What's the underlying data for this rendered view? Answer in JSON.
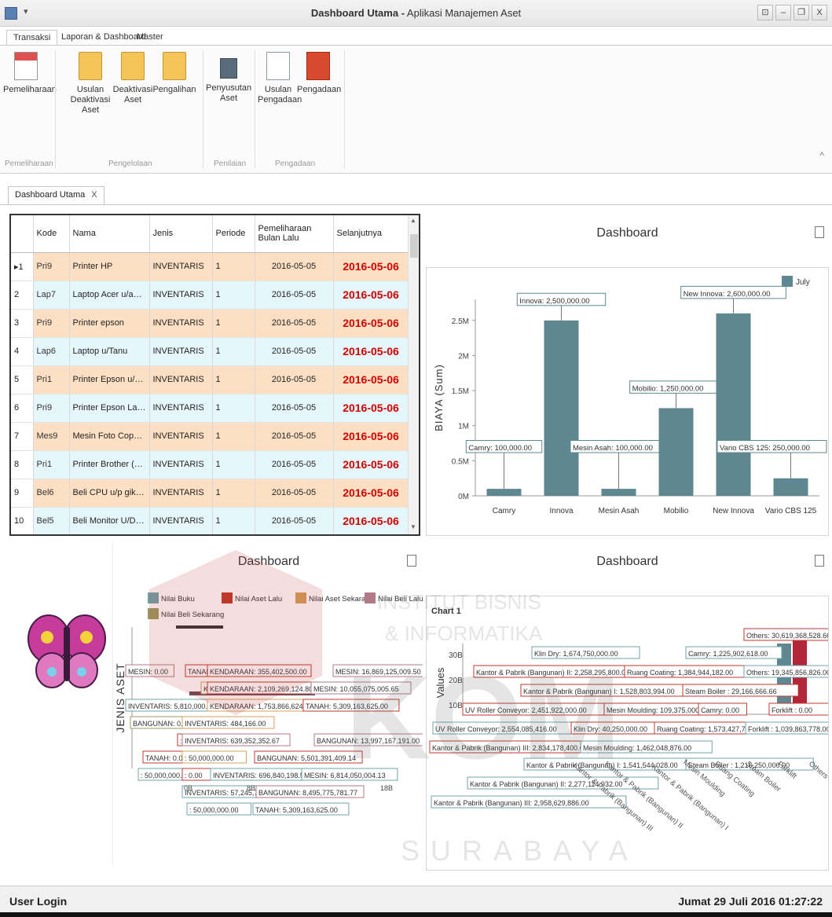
{
  "window": {
    "title_bold": "Dashboard Utama -",
    "title_rest": " Aplikasi Manajemen Aset",
    "qa_glyph": "▾",
    "controls": [
      "⊡",
      "–",
      "❐",
      "X"
    ]
  },
  "ribbon_tabs": [
    "Transaksi",
    "Laporan & Dashboard",
    "Master"
  ],
  "ribbon": {
    "buttons": [
      {
        "label1": "Pemeliharaan",
        "label2": ""
      },
      {
        "label1": "Usulan",
        "label2": "Deaktivasi Aset"
      },
      {
        "label1": "Deaktivasi",
        "label2": "Aset"
      },
      {
        "label1": "Pengalihan",
        "label2": ""
      },
      {
        "label1": "Penyusutan",
        "label2": "Aset"
      },
      {
        "label1": "Usulan",
        "label2": "Pengadaan"
      },
      {
        "label1": "Pengadaan",
        "label2": ""
      }
    ],
    "groups": [
      "Pemeliharaan",
      "Pengelolaan",
      "Penilaian",
      "Pengadaan"
    ],
    "collapse_glyph": "^"
  },
  "doc_tab": {
    "label": "Dashboard Utama",
    "close": "X"
  },
  "grid": {
    "columns": [
      "",
      "Kode",
      "Nama",
      "Jenis",
      "Periode",
      "Pemeliharaan Bulan Lalu",
      "Selanjutnya"
    ],
    "rows": [
      {
        "no": "▸1",
        "kode": "Pri9",
        "nama": "Printer HP",
        "jenis": "INVENTARIS",
        "periode": "1",
        "lalu": "2016-05-05",
        "next": "2016-05-06"
      },
      {
        "no": "2",
        "kode": "Lap7",
        "nama": "Laptop Acer u/aciek",
        "jenis": "INVENTARIS",
        "periode": "1",
        "lalu": "2016-05-05",
        "next": "2016-05-06"
      },
      {
        "no": "3",
        "kode": "Pri9",
        "nama": "Printer epson",
        "jenis": "INVENTARIS",
        "periode": "1",
        "lalu": "2016-05-05",
        "next": "2016-05-06"
      },
      {
        "no": "4",
        "kode": "Lap6",
        "nama": "Laptop u/Tanu",
        "jenis": "INVENTARIS",
        "periode": "1",
        "lalu": "2016-05-05",
        "next": "2016-05-06"
      },
      {
        "no": "5",
        "kode": "Pri1",
        "nama": "Printer Epson u/kantor...",
        "jenis": "INVENTARIS",
        "periode": "1",
        "lalu": "2016-05-05",
        "next": "2016-05-06"
      },
      {
        "no": "6",
        "kode": "Pri9",
        "nama": "Printer Epson Laser u/...",
        "jenis": "INVENTARIS",
        "periode": "1",
        "lalu": "2016-05-05",
        "next": "2016-05-06"
      },
      {
        "no": "7",
        "kode": "Mes9",
        "nama": "Mesin Foto Copy Brother",
        "jenis": "INVENTARIS",
        "periode": "1",
        "lalu": "2016-05-05",
        "next": "2016-05-06"
      },
      {
        "no": "8",
        "kode": "Pri1",
        "nama": "Printer Brother (B Her...",
        "jenis": "INVENTARIS",
        "periode": "1",
        "lalu": "2016-05-05",
        "next": "2016-05-06"
      },
      {
        "no": "9",
        "kode": "Bel6",
        "nama": "Beli CPU u/p gik export",
        "jenis": "INVENTARIS",
        "periode": "1",
        "lalu": "2016-05-05",
        "next": "2016-05-06"
      },
      {
        "no": "10",
        "kode": "Bel5",
        "nama": "Beli Monitor U/David",
        "jenis": "INVENTARIS",
        "periode": "1",
        "lalu": "2016-05-05",
        "next": "2016-05-06"
      }
    ]
  },
  "panels": {
    "top_right_title": "Dashboard",
    "bottom_left_title": "Dashboard",
    "bottom_right_title": "Dashboard"
  },
  "chart_data": [
    {
      "type": "bar",
      "title": "",
      "xlabel": "",
      "ylabel": "BIAYA (Sum)",
      "categories": [
        "Camry",
        "Innova",
        "Mesin Asah",
        "Mobilio",
        "New Innova",
        "Vario CBS 125"
      ],
      "series": [
        {
          "name": "July",
          "values": [
            100000,
            2500000,
            100000,
            1250000,
            2600000,
            250000
          ]
        }
      ],
      "data_labels": [
        "Camry: 100,000.00",
        "Innova: 2,500,000.00",
        "Mesin Asah: 100,000.00",
        "Mobilio: 1,250,000.00",
        "New Innova: 2,600,000.00",
        "Vario CBS 125: 250,000.00"
      ],
      "yticks": [
        "0M",
        "0.5M",
        "1M",
        "1.5M",
        "2M",
        "2.5M"
      ],
      "ylim": [
        0,
        2800000
      ],
      "legend": "top-right",
      "color": "#5f8791"
    },
    {
      "type": "bar",
      "title": "",
      "ylabel": "JENIS ASET",
      "legend_entries": [
        {
          "name": "Nilai Buku",
          "color": "#6fa3a9"
        },
        {
          "name": "Nilai Aset Lalu",
          "color": "#c0392b"
        },
        {
          "name": "Nilai Aset Sekarang",
          "color": "#d4a15a"
        },
        {
          "name": "Nilai Beli Lalu",
          "color": "#b07a86"
        },
        {
          "name": "Nilai Beli Sekarang",
          "color": "#9a9a62"
        }
      ],
      "xticks": [
        "0B",
        "8B",
        "18B"
      ],
      "labels": [
        {
          "text": "MESIN: 0.00",
          "border": "#b07a86"
        },
        {
          "text": "TANAH: 0.00",
          "border": "#c0392b"
        },
        {
          "text": "KENDARAAN: 355,402,500.00",
          "border": "#c0392b"
        },
        {
          "text": "MESIN: 16,869,125,009.50",
          "border": "#b07a86"
        },
        {
          "text": "KENDARAAN: 0.00",
          "border": "#d4a15a"
        },
        {
          "text": "KENDARAAN: 2,109,269,124.80",
          "border": "#c0392b"
        },
        {
          "text": "MESIN: 10,055,075,005.65",
          "border": "#b07a86"
        },
        {
          "text": "INVENTARIS: 5,810,000.00",
          "border": "#6fa3a9"
        },
        {
          "text": "KENDARAAN: 1,753,866,624.80",
          "border": "#d4a15a"
        },
        {
          "text": "TANAH: 5,309,163,625.00",
          "border": "#c0392b"
        },
        {
          "text": "BANGUNAN: 0.00",
          "border": "#9a9a62"
        },
        {
          "text": "INVENTARIS: 484,166.00",
          "border": "#d4a15a"
        },
        {
          "text": ": 0.00",
          "border": "#c0392b"
        },
        {
          "text": "INVENTARIS: 639,352,352.67",
          "border": "#b07a86"
        },
        {
          "text": "BANGUNAN: 13,997,167,191.00",
          "border": "#b07a86"
        },
        {
          "text": "TANAH: 0.00",
          "border": "#c0392b"
        },
        {
          "text": ": 50,000,000.00",
          "border": "#d4a15a"
        },
        {
          "text": "BANGUNAN: 5,501,391,409.14",
          "border": "#c0392b"
        },
        {
          "text": ": 50,000,000.00",
          "border": "#6fa3a9"
        },
        {
          "text": ": 0.00",
          "border": "#c0392b"
        },
        {
          "text": "INVENTARIS: 696,840,198.50",
          "border": "#6fa3a9"
        },
        {
          "text": "MESIN: 6,814,050,004.13",
          "border": "#6fa3a9"
        },
        {
          "text": "INVENTARIS: 57,245,763.17",
          "border": "#6fa3a9"
        },
        {
          "text": "BANGUNAN: 8,495,775,781.77",
          "border": "#b07a86"
        },
        {
          "text": ": 50,000,000.00",
          "border": "#6fa3a9"
        },
        {
          "text": "TANAH: 5,309,163,625.00",
          "border": "#6fa3a9"
        }
      ]
    },
    {
      "type": "bar",
      "title": "Chart 1",
      "ylabel": "Values",
      "yticks": [
        "10B",
        "20B",
        "30B"
      ],
      "categories_visible": [
        "Others"
      ],
      "labels": [
        {
          "text": "Others: 30,619,368,528.66",
          "border": "#c0392b"
        },
        {
          "text": "Klin Dry: 1,674,750,000.00",
          "border": "#6fa3a9"
        },
        {
          "text": "Camry: 1,225,902,618.00",
          "border": "#6fa3a9"
        },
        {
          "text": "Kantor & Pabrik (Bangunan) II: 2,258,295,800.00",
          "border": "#c0392b"
        },
        {
          "text": "Ruang Coating: 1,384,944,182.00",
          "border": "#c0392b"
        },
        {
          "text": "Others: 19,345,856,826.00",
          "border": "#6fa3a9"
        },
        {
          "text": "Kantor & Pabrik (Bangunan) I: 1,528,803,994.00",
          "border": "#c0392b"
        },
        {
          "text": "Steam Boiler : 29,166,666.66",
          "border": "#c0392b"
        },
        {
          "text": "UV Roller Conveyor: 2,451,922,000.00",
          "border": "#c0392b"
        },
        {
          "text": "Mesin Moulding: 109,375,000.00",
          "border": "#c0392b"
        },
        {
          "text": "Camry: 0.00",
          "border": "#c0392b"
        },
        {
          "text": "Forklift : 0.00",
          "border": "#c0392b"
        },
        {
          "text": "UV Roller Conveyor: 2,554,085,416.00",
          "border": "#6fa3a9"
        },
        {
          "text": "Klin Dry: 40,250,000.00",
          "border": "#c0392b"
        },
        {
          "text": "Ruang Coating: 1,573,427,708.80",
          "border": "#c0392b"
        },
        {
          "text": "Forklift : 1,039,863,778.00",
          "border": "#6fa3a9"
        },
        {
          "text": "Kantor & Pabrik (Bangunan) III: 2,834,178,400.00",
          "border": "#c0392b"
        },
        {
          "text": "Mesin Moulding: 1,462,048,876.00",
          "border": "#6fa3a9"
        },
        {
          "text": "Kantor & Pabrik (Bangunan) I: 1,541,544,028.00",
          "border": "#6fa3a9"
        },
        {
          "text": "Steam Boiler : 1,216,250,000.00",
          "border": "#6fa3a9"
        },
        {
          "text": "Kantor & Pabrik (Bangunan) II: 2,277,114,932.00",
          "border": "#6fa3a9"
        },
        {
          "text": "Kantor & Pabrik (Bangunan) III: 2,958,629,886.00",
          "border": "#6fa3a9"
        }
      ],
      "rotated_ticks": [
        "Kantor & Pabrik (Bangunan) III",
        "Kantor & Pabrik (Bangunan) II",
        "Kantor & Pabrik (Bangunan) I",
        "Mesin Moulding",
        "Ruang Coating",
        "Steam Boiler",
        "Forklift",
        "Others"
      ]
    }
  ],
  "status": {
    "left": "User Login",
    "right": "Jumat  29 Juli 2016  01:27:22"
  },
  "watermark": {
    "top": "INSTITUT BISNIS",
    "middle": "& INFORMATIKA",
    "big": "KOM",
    "bottom": "SURABAYA"
  }
}
